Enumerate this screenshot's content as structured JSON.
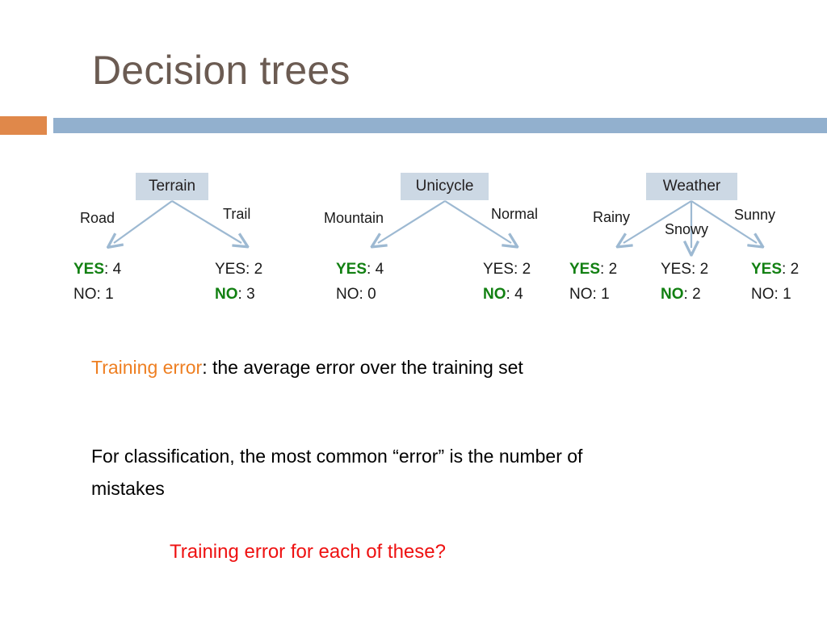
{
  "slide": {
    "title": "Decision trees",
    "title_color": "#6b5b52",
    "accent_orange": "#e0884a",
    "accent_blue": "#92b0ce",
    "node_fill": "#ccd8e4",
    "highlight_green": "#128012",
    "question_red": "#ee1111",
    "arrow_color": "#9db9d2"
  },
  "trees": [
    {
      "root_label": "Terrain",
      "branches": [
        {
          "edge_label": "Road",
          "yes_label": "YES",
          "yes_sep": ": ",
          "yes_count": "4",
          "yes_highlight": true,
          "no_label": "NO",
          "no_sep": ": ",
          "no_count": "1",
          "no_highlight": false
        },
        {
          "edge_label": "Trail",
          "yes_label": "YES",
          "yes_sep": ": ",
          "yes_count": "2",
          "yes_highlight": false,
          "no_label": "NO",
          "no_sep": ": ",
          "no_count": "3",
          "no_highlight": true
        }
      ]
    },
    {
      "root_label": "Unicycle",
      "branches": [
        {
          "edge_label": "Mountain",
          "yes_label": "YES",
          "yes_sep": ": ",
          "yes_count": "4",
          "yes_highlight": true,
          "no_label": "NO",
          "no_sep": ": ",
          "no_count": "0",
          "no_highlight": false
        },
        {
          "edge_label": "Normal",
          "yes_label": "YES",
          "yes_sep": ": ",
          "yes_count": "2",
          "yes_highlight": false,
          "no_label": "NO",
          "no_sep": ": ",
          "no_count": "4",
          "no_highlight": true
        }
      ]
    },
    {
      "root_label": "Weather",
      "branches": [
        {
          "edge_label": "Rainy",
          "yes_label": "YES",
          "yes_sep": ": ",
          "yes_count": "2",
          "yes_highlight": true,
          "no_label": "NO",
          "no_sep": ": ",
          "no_count": "1",
          "no_highlight": false
        },
        {
          "edge_label": "Snowy",
          "yes_label": "YES",
          "yes_sep": ": ",
          "yes_count": "2",
          "yes_highlight": false,
          "no_label": "NO",
          "no_sep": ": ",
          "no_count": "2",
          "no_highlight": true
        },
        {
          "edge_label": "Sunny",
          "yes_label": "YES",
          "yes_sep": ": ",
          "yes_count": "2",
          "yes_highlight": true,
          "no_label": "NO",
          "no_sep": ": ",
          "no_count": "1",
          "no_highlight": false
        }
      ]
    }
  ],
  "body": {
    "definition_term": "Training error",
    "definition_rest": ": the average error over the training set",
    "paragraph": "For classification, the most common “error” is the number of mistakes",
    "question": "Training error for each of these?"
  }
}
